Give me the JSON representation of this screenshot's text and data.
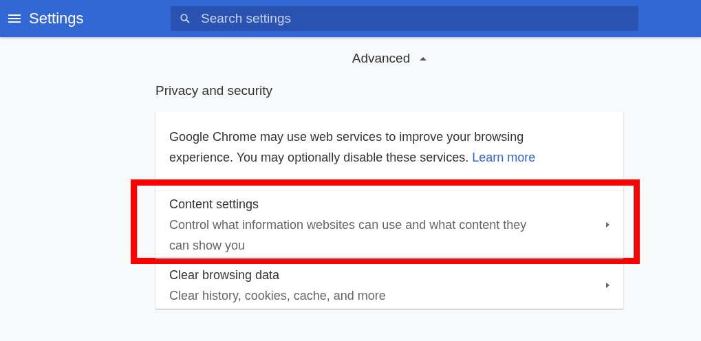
{
  "toolbar": {
    "title": "Settings",
    "search": {
      "placeholder": "Search settings"
    }
  },
  "advanced": {
    "label": "Advanced",
    "expanded": true
  },
  "section": {
    "title": "Privacy and security",
    "intro": {
      "text": "Google Chrome may use web services to improve your browsing experience. You may optionally disable these services.",
      "link": "Learn more"
    },
    "rows": [
      {
        "title": "Content settings",
        "subtitle": "Control what information websites can use and what content they can show you"
      },
      {
        "title": "Clear browsing data",
        "subtitle": "Clear history, cookies, cache, and more"
      }
    ]
  }
}
